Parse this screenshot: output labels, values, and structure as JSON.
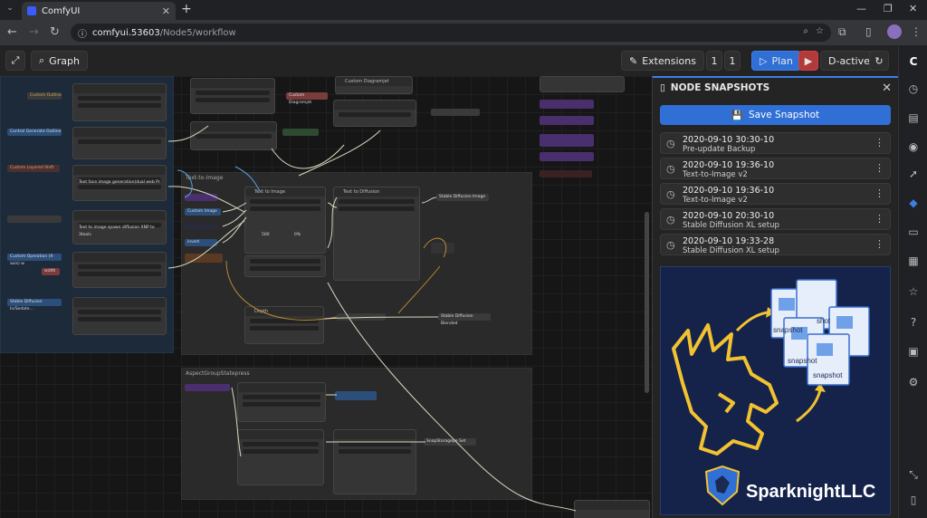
{
  "browser": {
    "tab_title": "ComfyUI",
    "tab_close": "✕",
    "new_tab": "+",
    "url_host": "comfyui.53603",
    "url_path": "/Node5/workflow"
  },
  "toolbar": {
    "graph_label": "Graph",
    "extensions_label": "Extensions",
    "counter_a": "1",
    "counter_b": "1",
    "plan_label": "Plan",
    "dactive_label": "D-active"
  },
  "panel": {
    "title": "NODE SNAPSHOTS",
    "save_label": "Save Snapshot",
    "snapshots": [
      {
        "time": "2020-09-10 30:30-10",
        "desc": "Pre-update Backup"
      },
      {
        "time": "2020-09-10 19:36-10",
        "desc": "Text-to-Image v2"
      },
      {
        "time": "2020-09-10 19:36-10",
        "desc": "Text-to-Image v2"
      },
      {
        "time": "2020-09-10 20:30-10",
        "desc": "Stable Diffusion XL setup"
      },
      {
        "time": "2020-09-10 19:33-28",
        "desc": "Stable Diffusion XL setup"
      }
    ],
    "promo": {
      "file_labels": [
        "snapshot",
        "snapshot",
        "shot",
        "snapshot"
      ],
      "brand": "SparknightLLC",
      "brand_color": "#f2c230",
      "bg_color": "#15234a"
    }
  },
  "canvas": {
    "groups": [
      {
        "title": "Text-to-Image"
      },
      {
        "title": "AspectGroupStatepress"
      }
    ],
    "nodes": [
      {
        "title": "Text to Image"
      },
      {
        "title": "Text to Diffusion"
      },
      {
        "title": "Depth"
      },
      {
        "title": "Custom Diagramjet"
      },
      {
        "title": "Depth"
      }
    ],
    "chips": [
      {
        "label": "Custom Outline"
      },
      {
        "label": "Control Generate Outline"
      },
      {
        "label": "Custom Layered Shift"
      },
      {
        "label": "Text face image generation(dual web Pr"
      },
      {
        "label": "Text to image spawn diffusion XNP to 3tools"
      },
      {
        "label": "Custom Operation (X-axis) w"
      },
      {
        "label": "width"
      },
      {
        "label": "Stable Diffusion In/Sedate…"
      },
      {
        "label": "Custom Image Generate"
      },
      {
        "label": "Stable Diffusion Image"
      },
      {
        "label": "Stable Diffusion Blended"
      },
      {
        "label": "SnapStoragepe Set"
      },
      {
        "label": "Custom Image"
      },
      {
        "label": "invert"
      },
      {
        "label": "500"
      },
      {
        "label": "0%"
      }
    ]
  },
  "colors": {
    "accent": "#2f6fd6",
    "danger": "#b23a3a",
    "chip_blue": "#2b4f7a",
    "chip_red": "#7a3b3b",
    "chip_purple": "#4a2f6e"
  }
}
